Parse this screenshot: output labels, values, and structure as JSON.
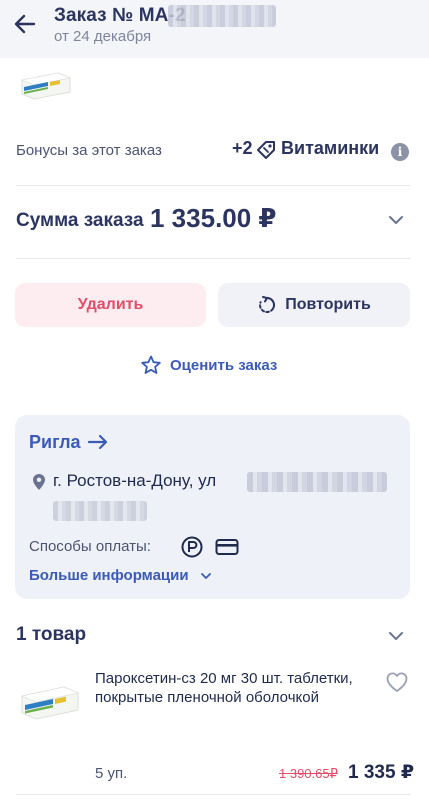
{
  "header": {
    "order_title": "Заказ № МА-2",
    "order_date": "от 24 декабря"
  },
  "bonus": {
    "label": "Бонусы за этот заказ",
    "value": "+2",
    "name": "Витаминки",
    "info_glyph": "i"
  },
  "summary": {
    "label": "Сумма заказа",
    "value": "1 335.00 ₽"
  },
  "actions": {
    "delete_label": "Удалить",
    "repeat_label": "Повторить",
    "rate_label": "Оценить заказ"
  },
  "store": {
    "name": "Ригла",
    "address": "г. Ростов-на-Дону, ул",
    "payment_label": "Способы оплаты:",
    "payment_methods": [
      "points-icon",
      "card-icon"
    ],
    "more_label": "Больше информации"
  },
  "items": {
    "title": "1 товар",
    "list": [
      {
        "name": "Пароксетин-сз 20 мг 30 шт. таблетки, покрытые пленочной оболочкой",
        "qty": "5 уп.",
        "old_price": "1 390.65₽",
        "price": "1 335 ₽"
      }
    ]
  },
  "colors": {
    "accent": "#3b5bb7",
    "title": "#2b3560",
    "danger": "#e24d67",
    "card_bg": "#eef1f7"
  }
}
